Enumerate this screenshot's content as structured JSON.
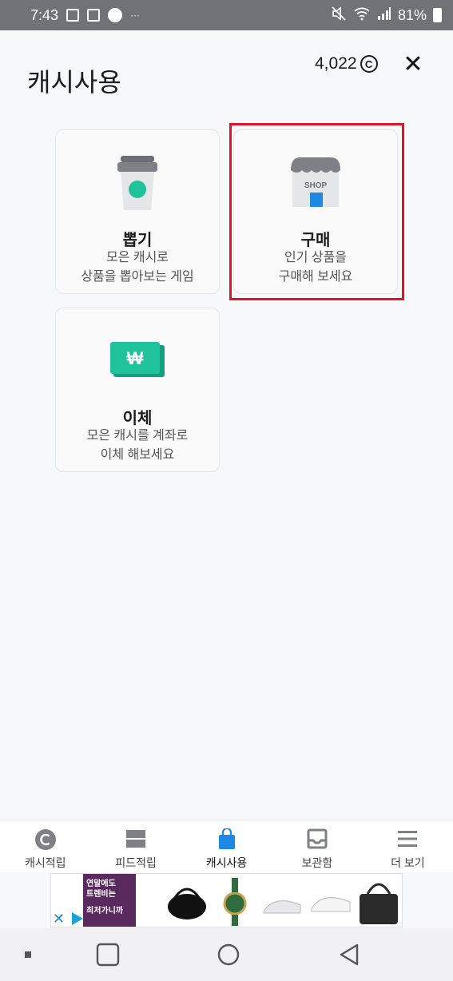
{
  "status_bar": {
    "time": "7:43",
    "battery": "81%"
  },
  "header": {
    "title": "캐시사용",
    "balance": "4,022",
    "coin_symbol": "C",
    "close_symbol": "✕"
  },
  "cards": {
    "draw": {
      "title": "뽑기",
      "desc_line1": "모은 캐시로",
      "desc_line2": "상품을 뽑아보는 게임"
    },
    "purchase": {
      "title": "구매",
      "desc_line1": "인기 상품을",
      "desc_line2": "구매해 보세요",
      "shop_sign": "SHOP"
    },
    "transfer": {
      "title": "이체",
      "desc_line1": "모은 캐시를 계좌로",
      "desc_line2": "이체 해보세요",
      "won_sign": "₩"
    }
  },
  "tabs": [
    {
      "label": "캐시적립",
      "icon": "coin-c-icon"
    },
    {
      "label": "피드적립",
      "icon": "feed-icon"
    },
    {
      "label": "캐시사용",
      "icon": "shopping-bag-icon"
    },
    {
      "label": "보관함",
      "icon": "inbox-icon"
    },
    {
      "label": "더 보기",
      "icon": "menu-icon"
    }
  ],
  "ad": {
    "text_line1": "연말에도",
    "text_line2": "트렌비는",
    "text_line3": "최저가니까"
  },
  "colors": {
    "accent": "#1e88e5",
    "highlight": "#e0122c",
    "green": "#1fc29a"
  }
}
